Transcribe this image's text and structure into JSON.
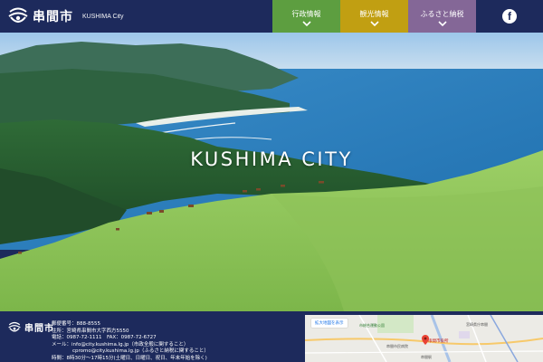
{
  "header": {
    "city_name": "串間市",
    "city_name_en": "KUSHIMA City",
    "nav": [
      {
        "label": "行政情報"
      },
      {
        "label": "観光情報"
      },
      {
        "label": "ふるさと納税"
      }
    ],
    "facebook": "f"
  },
  "hero": {
    "title": "KUSHIMA CITY"
  },
  "footer": {
    "city_name": "串間市",
    "postal": "郵便番号：888-8555",
    "address": "住所：宮崎県串間市大字西方5550",
    "phone": "電話：0987-72-1111　FAX：0987-72-6727",
    "mail1": "メール：info@city.kushima.lg.jp（市政全般に関すること）",
    "mail2": "cpromo@city.kushima.lg.jp（ふるさと納税に関すること）",
    "hours": "時間：8時30分～17時15分(土曜日、日曜日、祝日、年末年始を除く)"
  },
  "map": {
    "enlarge_button": "拡大地図を表示",
    "labels": {
      "sports_park": "市総合運動公園",
      "office": "宮崎県庁串間",
      "hospital": "串間市民病院",
      "city_hall": "串間市役所",
      "station": "串間駅"
    }
  },
  "colors": {
    "navy": "#1d2a5c",
    "nav_green": "#5d9e40",
    "nav_gold": "#c19f12",
    "nav_purple": "#846797"
  }
}
